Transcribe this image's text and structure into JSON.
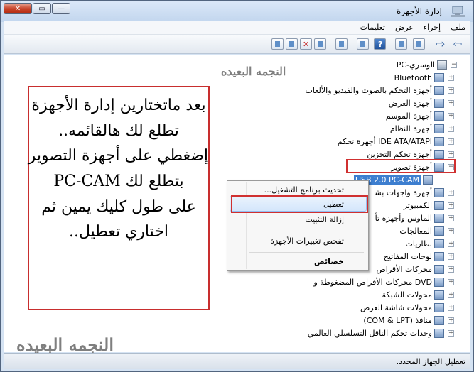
{
  "window": {
    "title": "إدارة الأجهزة"
  },
  "menu": [
    "ملف",
    "إجراء",
    "عرض",
    "تعليمات"
  ],
  "tree": {
    "root": "الوسري-PC",
    "items": [
      {
        "label": "Bluetooth",
        "expander": "+"
      },
      {
        "label": "أجهزة التحكم بالصوت والفيديو والألعاب",
        "expander": "+"
      },
      {
        "label": "أجهزة العرض",
        "expander": "+"
      },
      {
        "label": "أجهزة الموسم",
        "expander": "+"
      },
      {
        "label": "أجهزة النظام",
        "expander": "+"
      },
      {
        "label": "IDE ATA/ATAPI أجهزة تحكم",
        "expander": "+"
      },
      {
        "label": "أجهزة تحكم التخزين",
        "expander": "+"
      },
      {
        "label": "أجهزة تصوير",
        "expander": "−"
      },
      {
        "label": "USB 2.0 PC-CAM"
      },
      {
        "label": "أجهزة واجهات بشـ",
        "expander": "+"
      },
      {
        "label": "الكمبيوتر",
        "expander": "+"
      },
      {
        "label": "الماوس وأجهزة تأ",
        "expander": "+"
      },
      {
        "label": "المعالجات",
        "expander": "+"
      },
      {
        "label": "بطاريات",
        "expander": "+"
      },
      {
        "label": "لوحات المفاتيح",
        "expander": "+"
      },
      {
        "label": "محركات الأقراص",
        "expander": "+"
      },
      {
        "label": "DVD محركات الأقراص المضغوطة و",
        "expander": "+"
      },
      {
        "label": "محولات الشبكة",
        "expander": "+"
      },
      {
        "label": "محولات شاشة العرض",
        "expander": "+"
      },
      {
        "label": "منافذ (COM & LPT)",
        "expander": "+"
      },
      {
        "label": "وحدات تحكم الناقل التسلسلي العالمي",
        "expander": "+"
      }
    ]
  },
  "context_menu": {
    "update_driver": "تحديث برنامج التشغيل...",
    "disable": "تعطيل",
    "uninstall": "إزالة التثبيت",
    "scan": "تفحص تغييرات الأجهزة",
    "properties": "خصائص"
  },
  "note": {
    "lines": [
      "بعد ماتختارين إدارة الأجهزة",
      "تطلع لك هالقائمه..",
      "إضغطي على أجهزة التصوير",
      "بتطلع لك PC-CAM",
      "على طول كليك يمين ثم",
      "اختاري تعطيل.."
    ]
  },
  "watermark": "النجمه البعيده",
  "status": "تعطيل الجهاز المحدد."
}
